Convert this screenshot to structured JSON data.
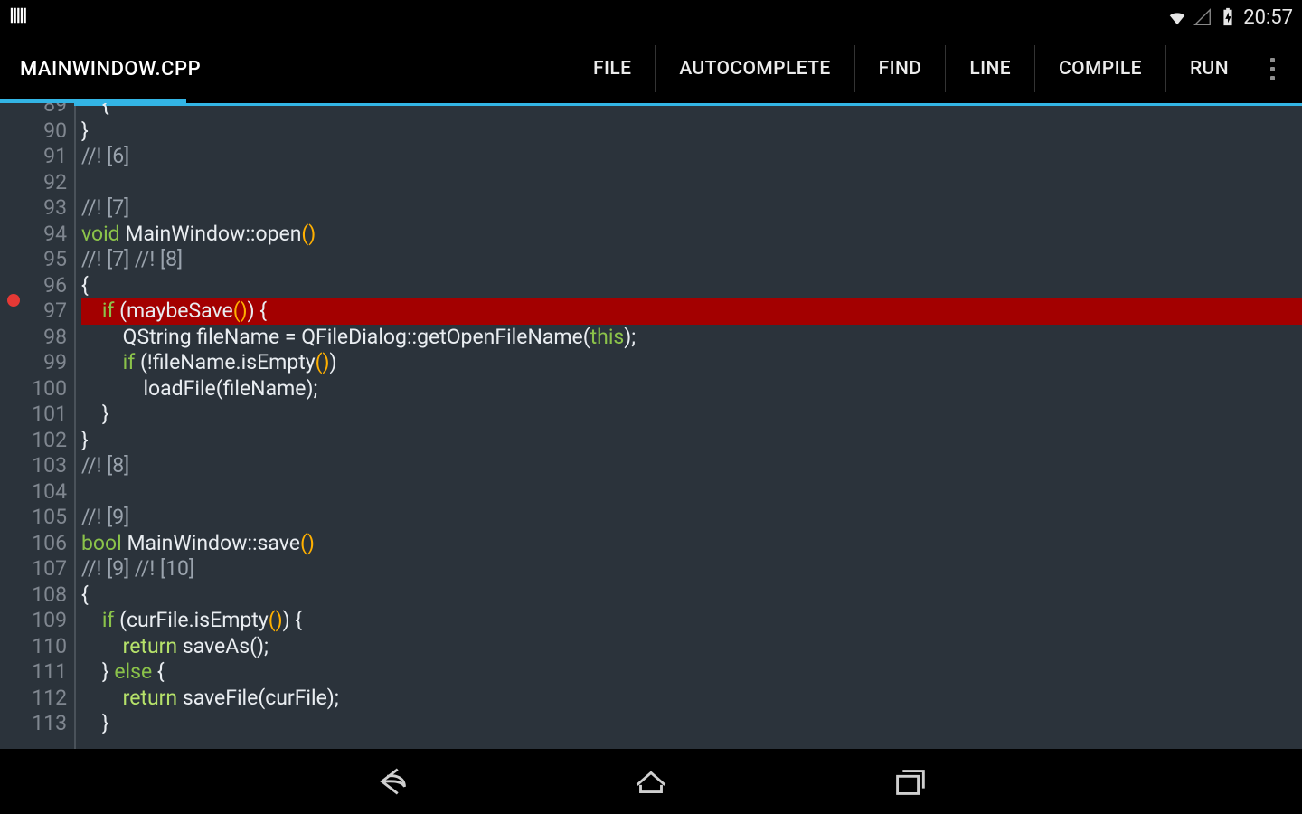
{
  "status": {
    "clock": "20:57"
  },
  "title": "MAINWINDOW.CPP",
  "menu": {
    "file": "FILE",
    "autocomplete": "AUTOCOMPLETE",
    "find": "FIND",
    "line": "LINE",
    "compile": "COMPILE",
    "run": "RUN"
  },
  "editor": {
    "first_line": 89,
    "breakpoint_line": 97,
    "highlighted_line": 97,
    "lines": [
      {
        "n": 89,
        "tokens": [
          {
            "t": "    {",
            "c": "txt"
          }
        ]
      },
      {
        "n": 90,
        "tokens": [
          {
            "t": "}",
            "c": "txt"
          }
        ]
      },
      {
        "n": 91,
        "tokens": [
          {
            "t": "//! [6]",
            "c": "cm"
          }
        ]
      },
      {
        "n": 92,
        "tokens": [
          {
            "t": "",
            "c": "txt"
          }
        ]
      },
      {
        "n": 93,
        "tokens": [
          {
            "t": "//! [7]",
            "c": "cm"
          }
        ]
      },
      {
        "n": 94,
        "tokens": [
          {
            "t": "void",
            "c": "kw"
          },
          {
            "t": " MainWindow::open",
            "c": "txt"
          },
          {
            "t": "()",
            "c": "paren"
          }
        ]
      },
      {
        "n": 95,
        "tokens": [
          {
            "t": "//! [7] //! [8]",
            "c": "cm"
          }
        ]
      },
      {
        "n": 96,
        "tokens": [
          {
            "t": "{",
            "c": "txt"
          }
        ]
      },
      {
        "n": 97,
        "tokens": [
          {
            "t": "    ",
            "c": "txt"
          },
          {
            "t": "if",
            "c": "kw"
          },
          {
            "t": " (maybeSave",
            "c": "txt"
          },
          {
            "t": "()",
            "c": "paren"
          },
          {
            "t": ") {",
            "c": "txt"
          }
        ]
      },
      {
        "n": 98,
        "tokens": [
          {
            "t": "        QString fileName = QFileDialog::getOpenFileName(",
            "c": "txt"
          },
          {
            "t": "this",
            "c": "kw"
          },
          {
            "t": ");",
            "c": "txt"
          }
        ]
      },
      {
        "n": 99,
        "tokens": [
          {
            "t": "        ",
            "c": "txt"
          },
          {
            "t": "if",
            "c": "kw"
          },
          {
            "t": " (!fileName.isEmpty",
            "c": "txt"
          },
          {
            "t": "()",
            "c": "paren"
          },
          {
            "t": ")",
            "c": "txt"
          }
        ]
      },
      {
        "n": 100,
        "tokens": [
          {
            "t": "            loadFile(fileName);",
            "c": "txt"
          }
        ]
      },
      {
        "n": 101,
        "tokens": [
          {
            "t": "    }",
            "c": "txt"
          }
        ]
      },
      {
        "n": 102,
        "tokens": [
          {
            "t": "}",
            "c": "txt"
          }
        ]
      },
      {
        "n": 103,
        "tokens": [
          {
            "t": "//! [8]",
            "c": "cm"
          }
        ]
      },
      {
        "n": 104,
        "tokens": [
          {
            "t": "",
            "c": "txt"
          }
        ]
      },
      {
        "n": 105,
        "tokens": [
          {
            "t": "//! [9]",
            "c": "cm"
          }
        ]
      },
      {
        "n": 106,
        "tokens": [
          {
            "t": "bool",
            "c": "kw"
          },
          {
            "t": " MainWindow::save",
            "c": "txt"
          },
          {
            "t": "()",
            "c": "paren"
          }
        ]
      },
      {
        "n": 107,
        "tokens": [
          {
            "t": "//! [9] //! [10]",
            "c": "cm"
          }
        ]
      },
      {
        "n": 108,
        "tokens": [
          {
            "t": "{",
            "c": "txt"
          }
        ]
      },
      {
        "n": 109,
        "tokens": [
          {
            "t": "    ",
            "c": "txt"
          },
          {
            "t": "if",
            "c": "kw"
          },
          {
            "t": " (curFile.isEmpty",
            "c": "txt"
          },
          {
            "t": "()",
            "c": "paren"
          },
          {
            "t": ") {",
            "c": "txt"
          }
        ]
      },
      {
        "n": 110,
        "tokens": [
          {
            "t": "        ",
            "c": "txt"
          },
          {
            "t": "return",
            "c": "kw2"
          },
          {
            "t": " saveAs();",
            "c": "txt"
          }
        ]
      },
      {
        "n": 111,
        "tokens": [
          {
            "t": "    } ",
            "c": "txt"
          },
          {
            "t": "else",
            "c": "kw"
          },
          {
            "t": " {",
            "c": "txt"
          }
        ]
      },
      {
        "n": 112,
        "tokens": [
          {
            "t": "        ",
            "c": "txt"
          },
          {
            "t": "return",
            "c": "kw2"
          },
          {
            "t": " saveFile(curFile);",
            "c": "txt"
          }
        ]
      },
      {
        "n": 113,
        "tokens": [
          {
            "t": "    }",
            "c": "txt"
          }
        ]
      }
    ]
  }
}
